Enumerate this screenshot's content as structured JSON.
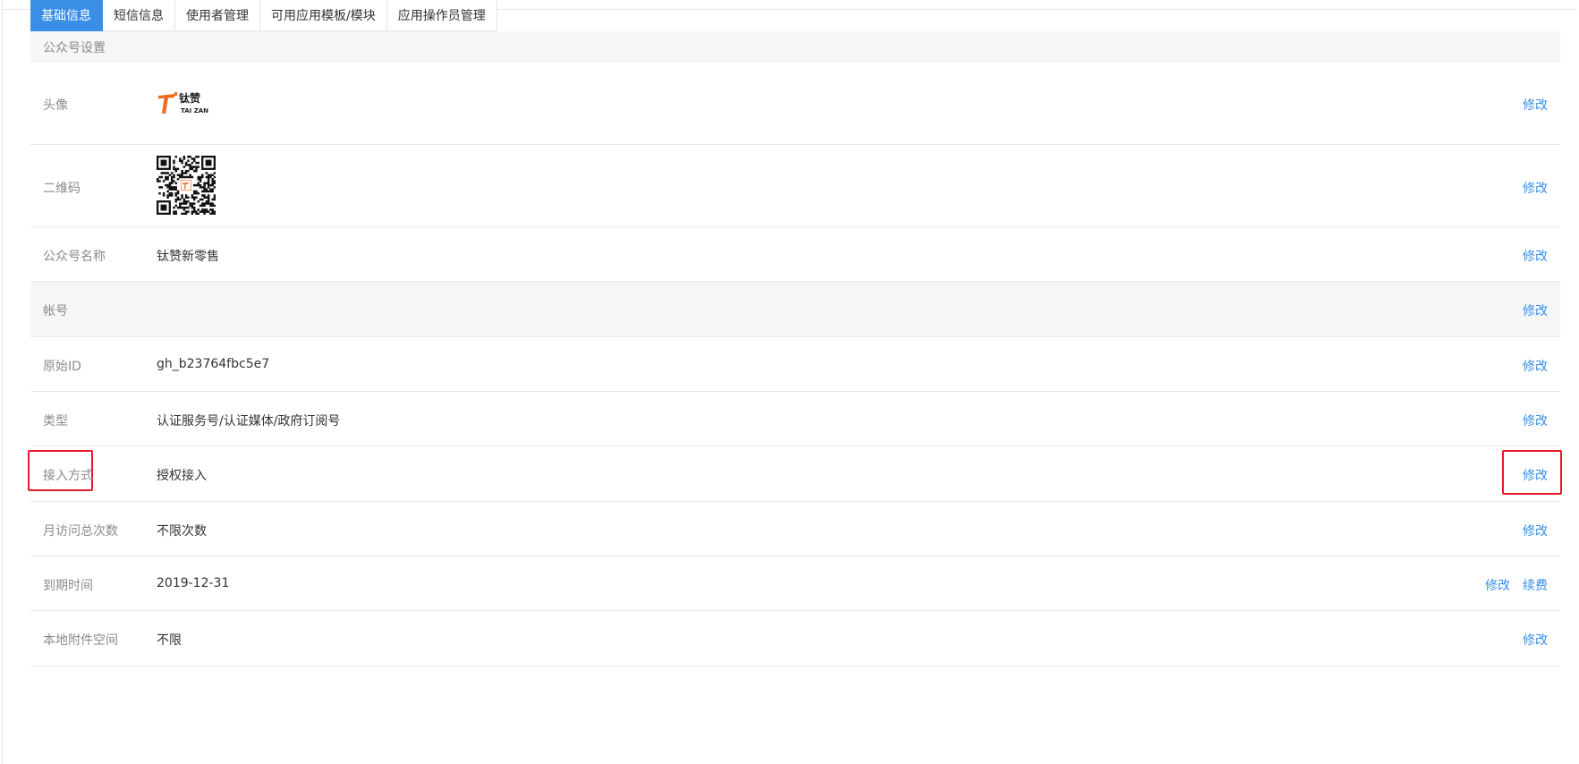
{
  "tabs": [
    {
      "label": "基础信息",
      "active": true
    },
    {
      "label": "短信信息",
      "active": false
    },
    {
      "label": "使用者管理",
      "active": false
    },
    {
      "label": "可用应用模板/模块",
      "active": false
    },
    {
      "label": "应用操作员管理",
      "active": false
    }
  ],
  "section": {
    "title": "公众号设置"
  },
  "rows": {
    "avatar": {
      "label": "头像",
      "logo_text": "钛赞",
      "logo_sub": "TAI ZAN",
      "action": "修改"
    },
    "qrcode": {
      "label": "二维码",
      "action": "修改"
    },
    "name": {
      "label": "公众号名称",
      "value": "钛赞新零售",
      "action": "修改"
    },
    "account": {
      "label": "帐号",
      "action": "修改"
    },
    "original_id": {
      "label": "原始ID",
      "value": "gh_b23764fbc5e7",
      "action": "修改"
    },
    "type": {
      "label": "类型",
      "value": "认证服务号/认证媒体/政府订阅号",
      "action": "修改"
    },
    "access": {
      "label": "接入方式",
      "value": "授权接入",
      "action": "修改"
    },
    "monthly_visits": {
      "label": "月访问总次数",
      "value": "不限次数",
      "action": "修改"
    },
    "expire": {
      "label": "到期时间",
      "value": "2019-12-31",
      "action": "修改",
      "action2": "续费"
    },
    "storage": {
      "label": "本地附件空间",
      "value": "不限",
      "action": "修改"
    }
  },
  "colors": {
    "accent": "#3a8ee6",
    "highlight": "#e8182a",
    "logo_orange": "#f26b1d"
  }
}
